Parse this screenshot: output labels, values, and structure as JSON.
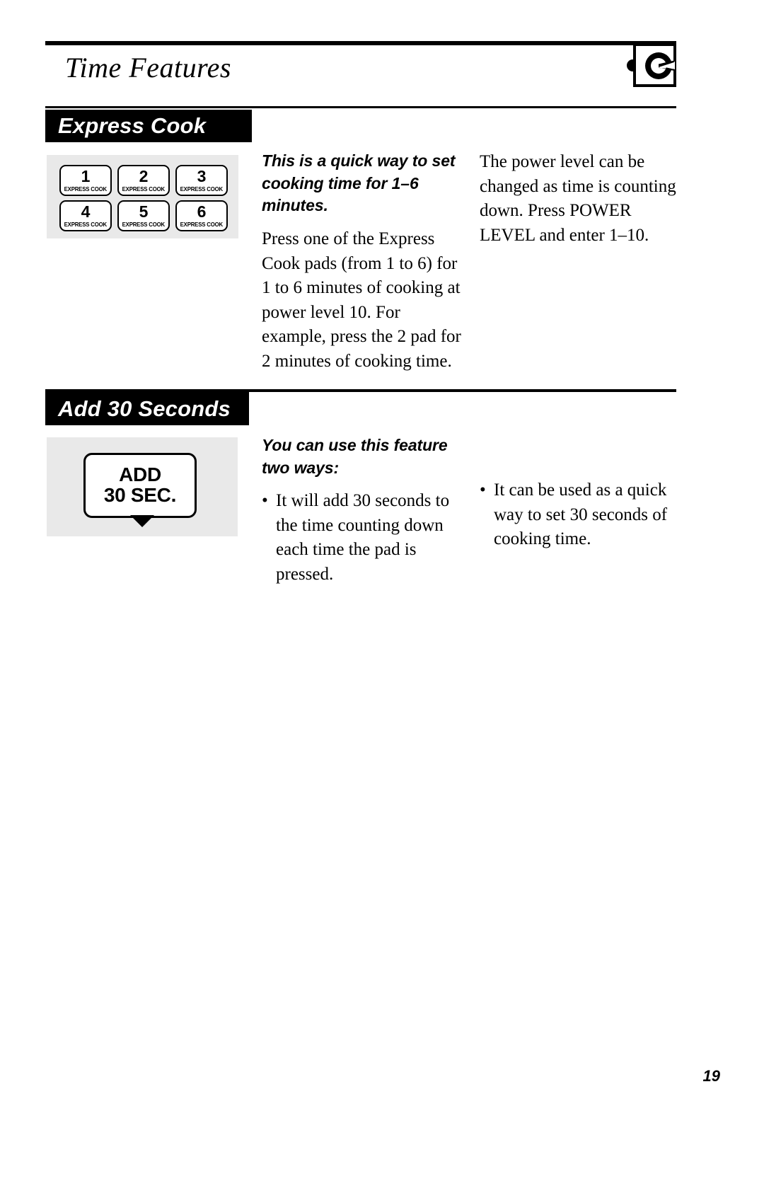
{
  "header": {
    "title": "Time Features",
    "icon_name": "control-knob-icon",
    "page_number": "19"
  },
  "sections": [
    {
      "banner": "Express Cook",
      "artwork": {
        "type": "keypad",
        "keys": [
          {
            "number": "1",
            "label": "EXPRESS COOK"
          },
          {
            "number": "2",
            "label": "EXPRESS COOK"
          },
          {
            "number": "3",
            "label": "EXPRESS COOK"
          },
          {
            "number": "4",
            "label": "EXPRESS COOK"
          },
          {
            "number": "5",
            "label": "EXPRESS COOK"
          },
          {
            "number": "6",
            "label": "EXPRESS COOK"
          }
        ]
      },
      "middle_column": {
        "lead": "This is a quick way to set cooking time for 1–6 minutes.",
        "body": "Press one of the Express Cook pads (from 1 to 6) for 1 to 6 minutes of cooking at power level 10. For example, press the 2 pad for 2 minutes of cooking time."
      },
      "right_column": {
        "body": "The power level can be changed as time is counting down. Press POWER LEVEL and enter 1–10."
      }
    },
    {
      "banner": "Add 30 Seconds",
      "artwork": {
        "type": "pad",
        "line1": "ADD",
        "line2": "30 SEC."
      },
      "middle_column": {
        "lead": "You can use this feature two ways:",
        "bullets": [
          "It will add 30 seconds to the time counting down each time the pad is pressed."
        ]
      },
      "right_column": {
        "bullets": [
          "It can be used as a quick way to set 30 seconds of cooking time."
        ]
      }
    }
  ]
}
